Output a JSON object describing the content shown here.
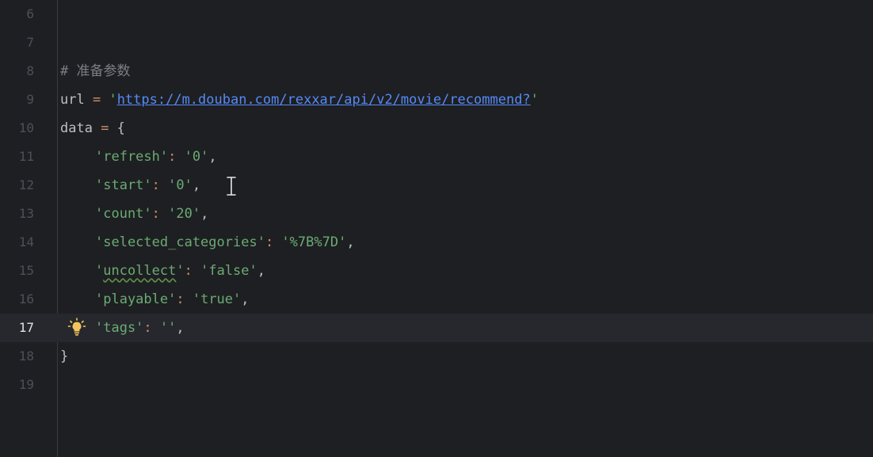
{
  "editor": {
    "lines": [
      {
        "num": "6"
      },
      {
        "num": "7"
      },
      {
        "num": "8",
        "comment": "# 准备参数"
      },
      {
        "num": "9",
        "var": "url",
        "op": " = ",
        "q1": "'",
        "url": "https://m.douban.com/rexxar/api/v2/movie/recommend?",
        "q2": "'"
      },
      {
        "num": "10",
        "var": "data",
        "op": " = ",
        "brace": "{"
      },
      {
        "num": "11",
        "key": "'refresh'",
        "colon": ": ",
        "val": "'0'",
        "comma": ","
      },
      {
        "num": "12",
        "key": "'start'",
        "colon": ": ",
        "val": "'0'",
        "comma": ","
      },
      {
        "num": "13",
        "key": "'count'",
        "colon": ": ",
        "val": "'20'",
        "comma": ","
      },
      {
        "num": "14",
        "key": "'selected_categories'",
        "colon": ": ",
        "val": "'%7B%7D'",
        "comma": ","
      },
      {
        "num": "15",
        "key_q": "'",
        "key_word": "uncollect",
        "key_q2": "'",
        "colon": ": ",
        "val": "'false'",
        "comma": ","
      },
      {
        "num": "16",
        "key": "'playable'",
        "colon": ": ",
        "val": "'true'",
        "comma": ","
      },
      {
        "num": "17",
        "key": "'tags'",
        "colon": ": ",
        "val": "''",
        "comma": ","
      },
      {
        "num": "18",
        "brace": "}"
      },
      {
        "num": "19"
      }
    ],
    "current_line": "17",
    "colors": {
      "background": "#1e1f22",
      "current_line": "#26282e",
      "string": "#6aab73",
      "operator": "#cf8e6d",
      "url": "#548af7",
      "comment": "#7a7e85",
      "lightbulb": "#f2c55c"
    },
    "icons": {
      "lightbulb": "lightbulb-icon",
      "cursor": "text-cursor-icon"
    }
  }
}
